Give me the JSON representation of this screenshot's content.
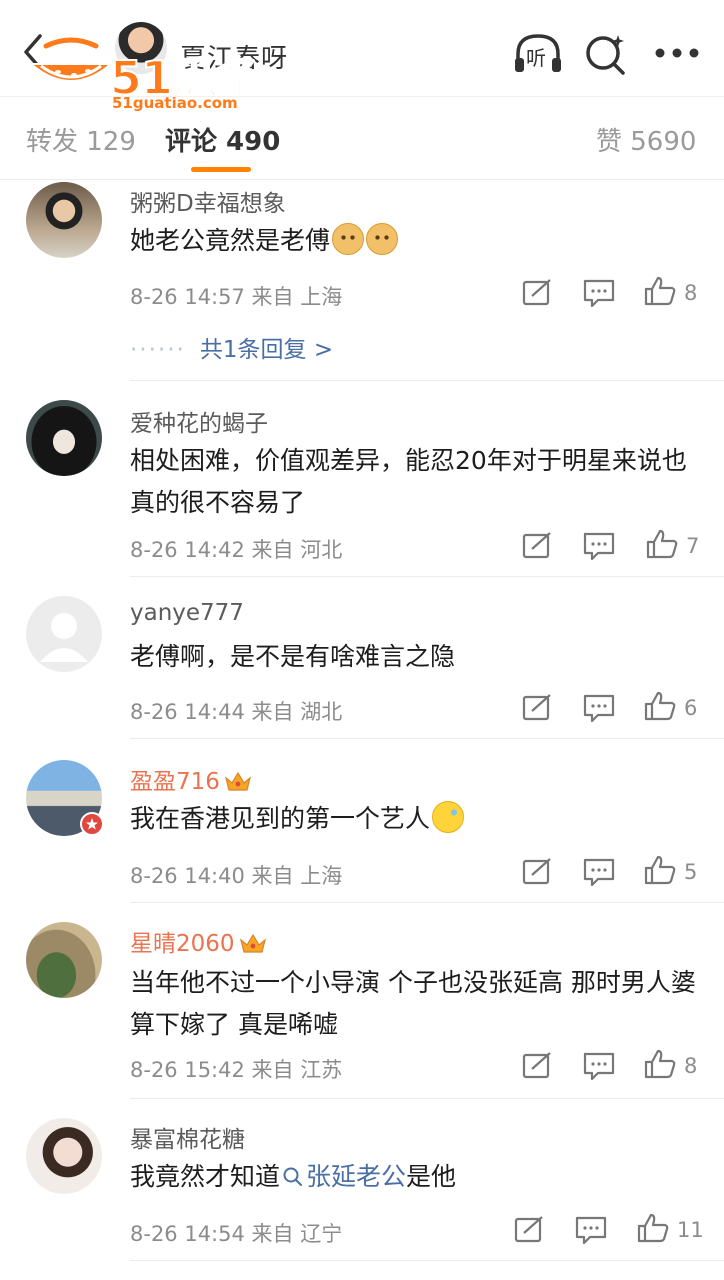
{
  "header": {
    "title": "夏江春呀",
    "listen_label": "听",
    "watermark_text": "51瓜条",
    "watermark_url": "51guatiao.com"
  },
  "tabs": [
    {
      "label": "转发 129"
    },
    {
      "label": "评论 490"
    },
    {
      "label": "赞 5690"
    }
  ],
  "colors": {
    "accent": "#ff8200",
    "vip_name": "#eb7350",
    "link": "#4a6fa5"
  },
  "comments": [
    {
      "name": "粥粥D幸福想象",
      "text": "她老公竟然是老傅",
      "emojis": [
        "doge",
        "doge"
      ],
      "meta": "8-26 14:57 来自 上海",
      "likes": "8",
      "reply_link": "共1条回复 >",
      "vip": false
    },
    {
      "name": "爱种花的蝎子",
      "text": "相处困难，价值观差异，能忍20年对于明星来说也真的很不容易了",
      "meta": "8-26 14:42 来自 河北",
      "likes": "7",
      "vip": false
    },
    {
      "name": "yanye777",
      "text": "老傅啊，是不是有啥难言之隐",
      "meta": "8-26 14:44 来自 湖北",
      "likes": "6",
      "vip": false
    },
    {
      "name": "盈盈716",
      "text": "我在香港见到的第一个艺人",
      "emojis": [
        "sweat"
      ],
      "meta": "8-26 14:40 来自 上海",
      "likes": "5",
      "vip": true
    },
    {
      "name": "星晴2060",
      "text": "当年他不过一个小导演 个子也没张延高 那时男人婆算下嫁了 真是唏嘘",
      "meta": "8-26 15:42 来自 江苏",
      "likes": "8",
      "vip": true
    },
    {
      "name": "暴富棉花糖",
      "text_before": "我竟然才知道",
      "topic": "张延老公",
      "text_after": "是他",
      "meta": "8-26 14:54 来自 辽宁",
      "likes": "11",
      "vip": false
    }
  ]
}
